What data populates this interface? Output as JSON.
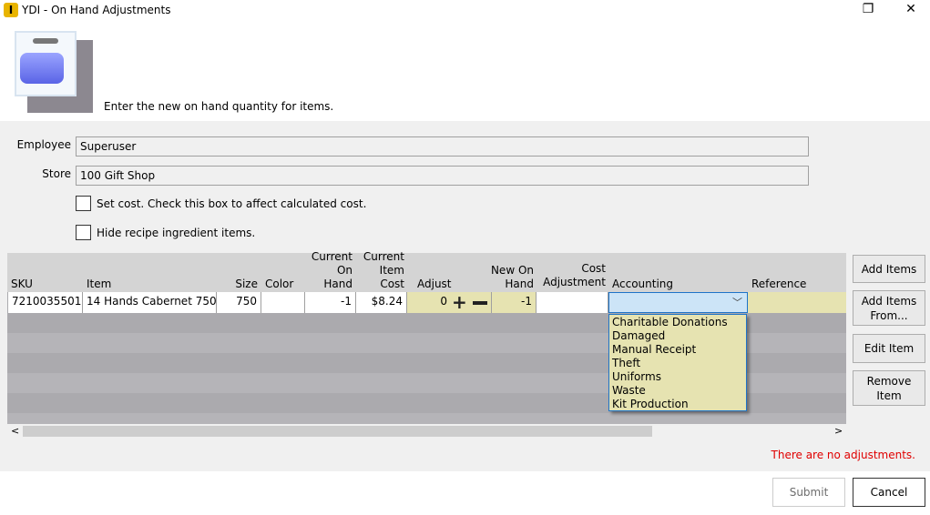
{
  "window": {
    "title": "YDI - On Hand Adjustments",
    "app_icon": "ydi-logo-icon"
  },
  "header": {
    "instruction": "Enter the new on hand quantity for items.",
    "illustration": "package-icon"
  },
  "form": {
    "employee_label": "Employee",
    "employee_value": "Superuser",
    "store_label": "Store",
    "store_value": "100 Gift Shop",
    "set_cost_label": "Set cost. Check this box to affect calculated cost.",
    "set_cost_checked": false,
    "hide_recipe_label": "Hide recipe ingredient items.",
    "hide_recipe_checked": false
  },
  "grid": {
    "columns": [
      {
        "l1": "",
        "l2": "SKU"
      },
      {
        "l1": "",
        "l2": "Item"
      },
      {
        "l1": "",
        "l2": "Size"
      },
      {
        "l1": "",
        "l2": "Color"
      },
      {
        "l1": "Current",
        "l2": "On Hand"
      },
      {
        "l1": "Current",
        "l2": "Item Cost"
      },
      {
        "l1": "",
        "l2": "Adjust"
      },
      {
        "l1": "New On",
        "l2": "Hand"
      },
      {
        "l1": "Cost",
        "l2": "Adjustment"
      },
      {
        "l1": "",
        "l2": "Accounting"
      },
      {
        "l1": "",
        "l2": "Reference"
      }
    ],
    "row": {
      "sku": "7210035501",
      "item": "14 Hands Cabernet  750",
      "size": "750",
      "color": "",
      "on_hand": "-1",
      "item_cost": "$8.24",
      "adjust": "0",
      "new_on_hand": "-1",
      "cost_adjustment": "",
      "accounting": "",
      "reference": ""
    },
    "accounting_options": [
      "Charitable Donations",
      "Damaged",
      "Manual Receipt",
      "Theft",
      "Uniforms",
      "Waste",
      "Kit Production"
    ]
  },
  "side_buttons": {
    "add_items": "Add Items",
    "add_items_from_1": "Add Items",
    "add_items_from_2": "From...",
    "edit_item": "Edit Item",
    "remove_item_1": "Remove",
    "remove_item_2": "Item"
  },
  "status": {
    "message": "There are no adjustments.",
    "color": "#e00000"
  },
  "footer": {
    "submit": "Submit",
    "cancel": "Cancel"
  }
}
